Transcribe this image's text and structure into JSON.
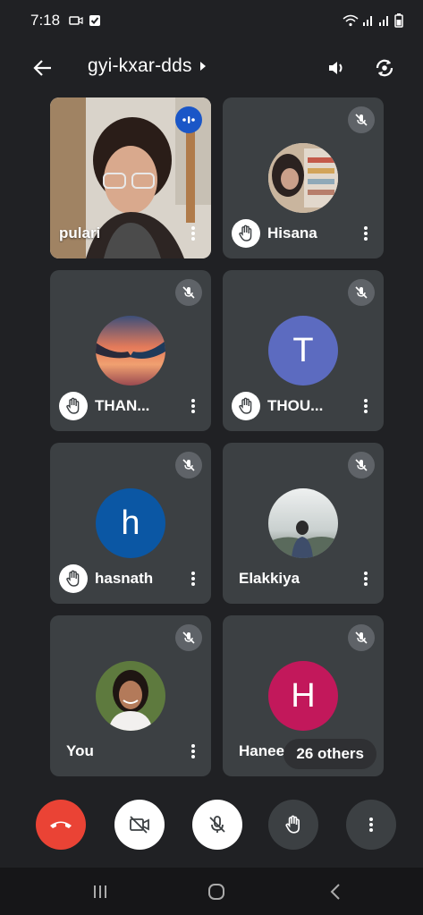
{
  "status_bar": {
    "time": "7:18"
  },
  "header": {
    "meeting_code": "gyi-kxar-dds"
  },
  "participants": [
    {
      "name": "pulari",
      "hand_raised": false,
      "muted": false,
      "speaking": true
    },
    {
      "name": "Hisana",
      "hand_raised": true,
      "muted": true
    },
    {
      "name": "THAN...",
      "hand_raised": true,
      "muted": true
    },
    {
      "name": "THOU...",
      "hand_raised": true,
      "muted": true,
      "initial": "T",
      "avatar_color": "#5c6bc0"
    },
    {
      "name": "hasnath",
      "hand_raised": true,
      "muted": true,
      "initial": "h",
      "avatar_color": "#0b57a4"
    },
    {
      "name": "Elakkiya",
      "hand_raised": false,
      "muted": true
    },
    {
      "name": "You",
      "hand_raised": false,
      "muted": true
    },
    {
      "name": "Haneena",
      "hand_raised": false,
      "muted": true,
      "initial": "H",
      "avatar_color": "#c2185b"
    }
  ],
  "others_pill": "26 others",
  "controls": {
    "end_call_color": "#ea4335",
    "icons": [
      "end-call-icon",
      "camera-off-icon",
      "mic-off-icon",
      "raise-hand-icon",
      "more-vert-icon"
    ]
  }
}
